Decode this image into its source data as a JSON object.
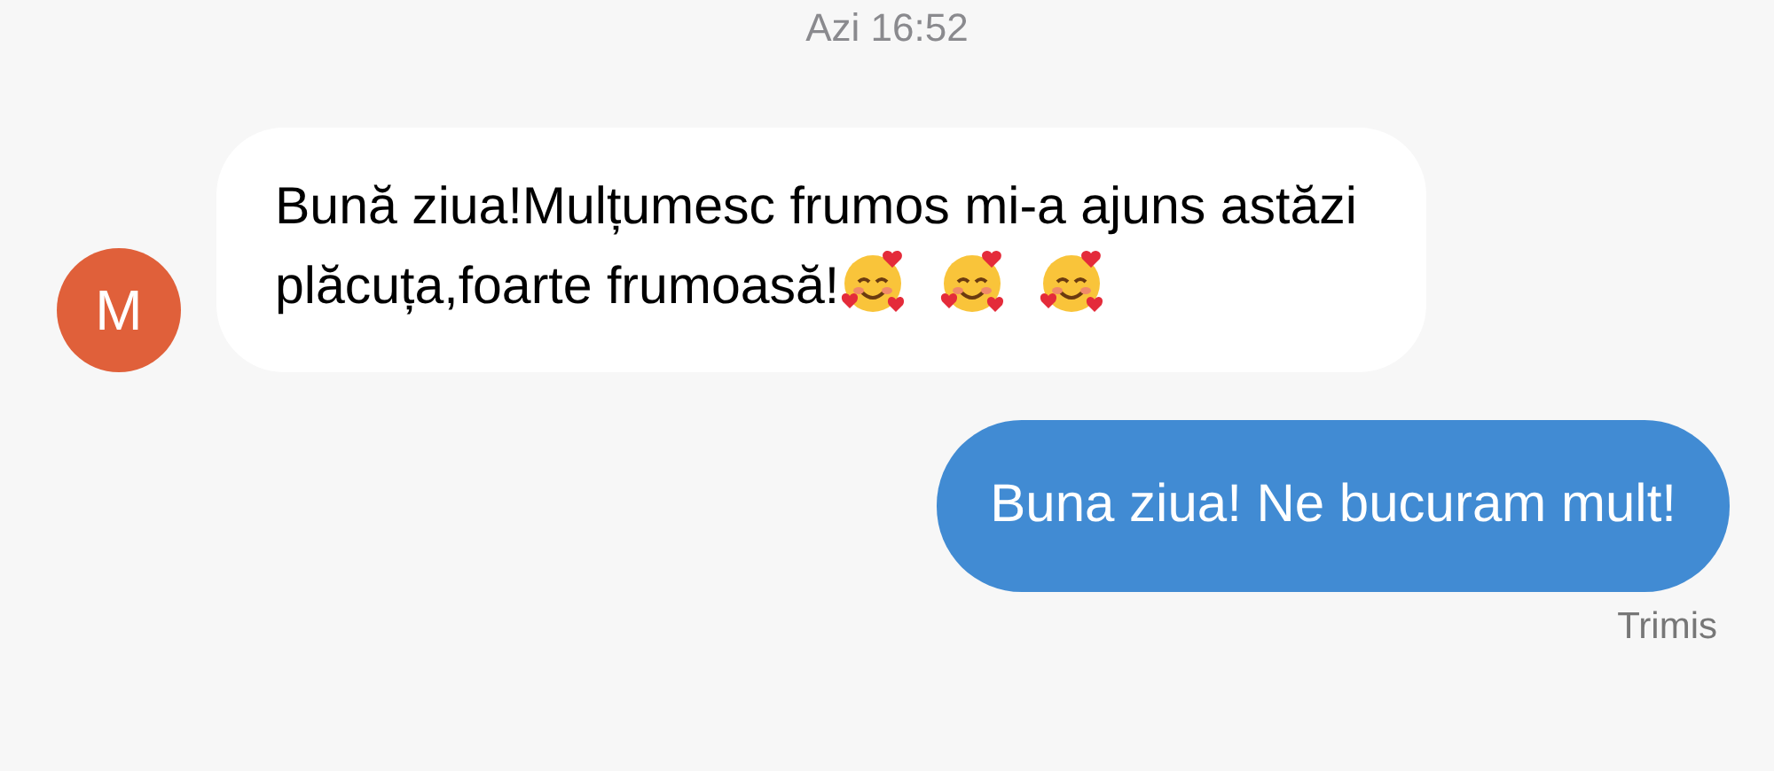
{
  "timestamp": "Azi 16:52",
  "messages": [
    {
      "kind": "incoming",
      "avatar": "M",
      "text": "Bună ziua!Mulțumesc frumos mi-a ajuns astăzi plăcuța,foarte frumoasă!",
      "emojis": [
        {
          "kind": "smiling-face-with-hearts"
        },
        {
          "kind": "smiling-face-with-hearts"
        },
        {
          "kind": "smiling-face-with-hearts"
        }
      ]
    },
    {
      "kind": "outgoing",
      "text": "Buna ziua! Ne bucuram mult!",
      "status": "Trimis"
    }
  ]
}
